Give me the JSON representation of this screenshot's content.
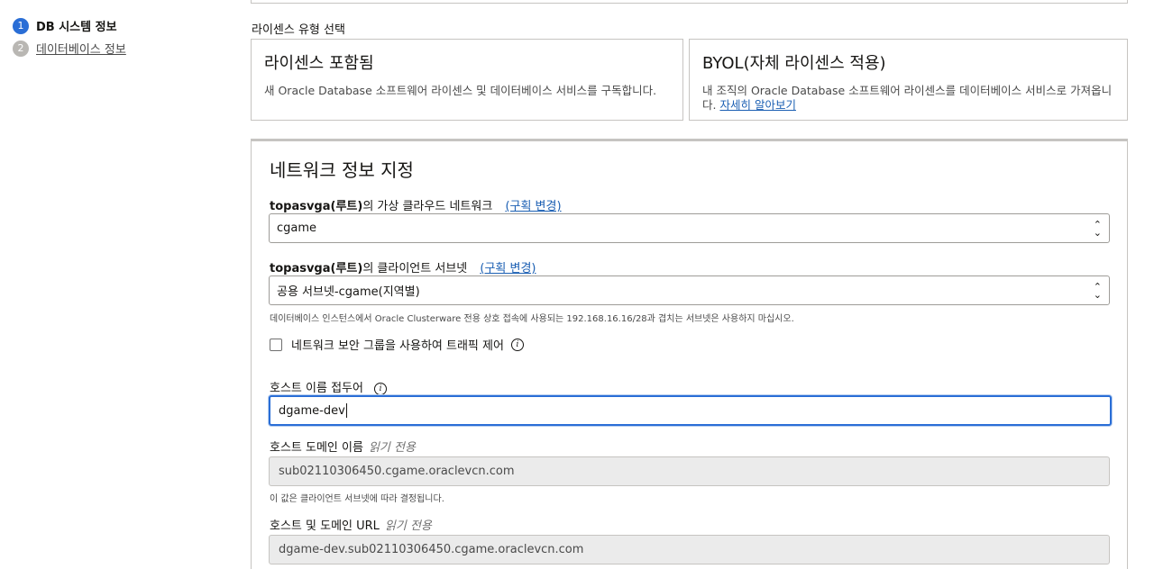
{
  "steps": [
    {
      "num": "1",
      "label": "DB 시스템 정보"
    },
    {
      "num": "2",
      "label": "데이터베이스 정보"
    }
  ],
  "license": {
    "section_label": "라이센스 유형 선택",
    "included": {
      "title": "라이센스 포함됨",
      "desc": "새 Oracle Database 소프트웨어 라이센스 및 데이터베이스 서비스를 구독합니다."
    },
    "byol": {
      "title": "BYOL(자체 라이센스 적용)",
      "desc": "내 조직의 Oracle Database 소프트웨어 라이센스를 데이터베이스 서비스로 가져옵니다.",
      "link": "자세히 알아보기"
    }
  },
  "network": {
    "title": "네트워크 정보 지정",
    "vcn": {
      "compartment": "topasvga(루트)",
      "label_suffix": "의 가상 클라우드 네트워크",
      "change_link": "(구획 변경)",
      "value": "cgame"
    },
    "subnet": {
      "compartment": "topasvga(루트)",
      "label_suffix": "의 클라이언트 서브넷",
      "change_link": "(구획 변경)",
      "value": "공용 서브넷-cgame(지역별)",
      "help": "데이터베이스 인스턴스에서 Oracle Clusterware 전용 상호 접속에 사용되는 192.168.16.16/28과 겹치는 서브넷은 사용하지 마십시오."
    },
    "nsg_checkbox_label": "네트워크 보안 그룹을 사용하여 트래픽 제어",
    "hostname": {
      "label": "호스트 이름 접두어",
      "value": "dgame-dev"
    },
    "domain": {
      "label": "호스트 도메인 이름",
      "readonly_label": "읽기 전용",
      "value": "sub02110306450.cgame.oraclevcn.com",
      "help": "이 값은 클라이언트 서브넷에 따라 결정됩니다."
    },
    "url": {
      "label": "호스트 및 도메인 URL",
      "readonly_label": "읽기 전용",
      "value": "dgame-dev.sub02110306450.cgame.oraclevcn.com"
    }
  },
  "icons": {
    "info": "i",
    "chevron": "updown-chevron-icon"
  }
}
